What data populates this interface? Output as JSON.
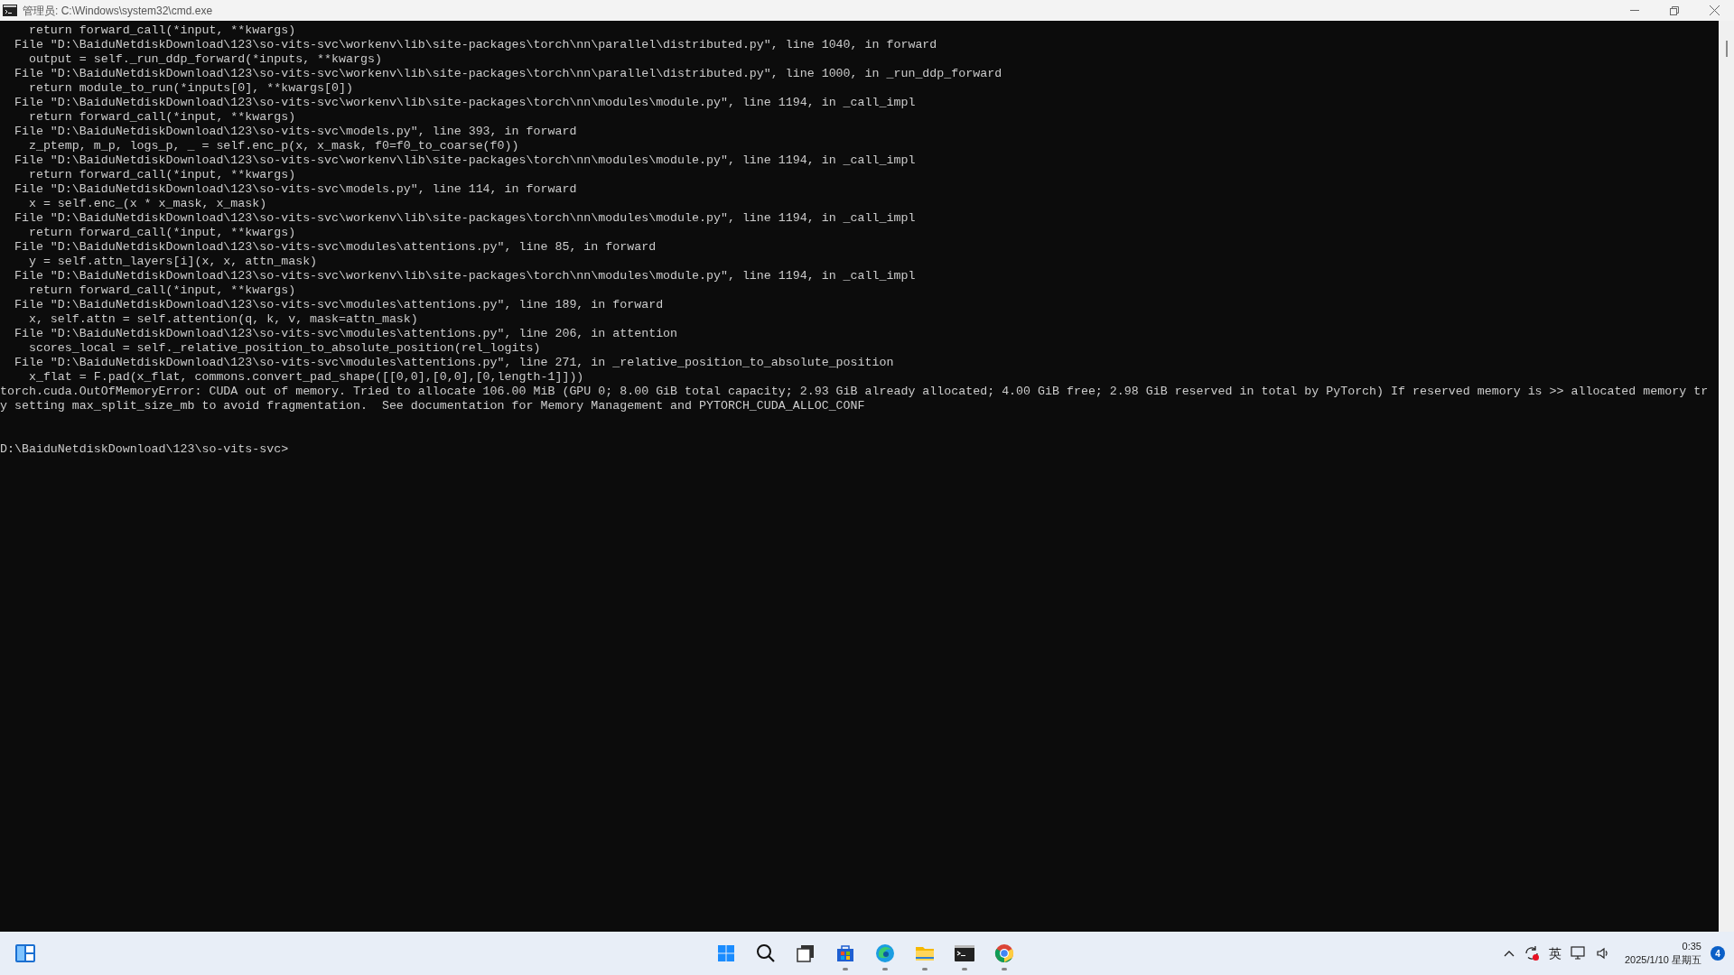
{
  "window": {
    "title": "管理员: C:\\Windows\\system32\\cmd.exe"
  },
  "console": {
    "lines": [
      "    return forward_call(*input, **kwargs)",
      "  File \"D:\\BaiduNetdiskDownload\\123\\so-vits-svc\\workenv\\lib\\site-packages\\torch\\nn\\parallel\\distributed.py\", line 1040, in forward",
      "    output = self._run_ddp_forward(*inputs, **kwargs)",
      "  File \"D:\\BaiduNetdiskDownload\\123\\so-vits-svc\\workenv\\lib\\site-packages\\torch\\nn\\parallel\\distributed.py\", line 1000, in _run_ddp_forward",
      "    return module_to_run(*inputs[0], **kwargs[0])",
      "  File \"D:\\BaiduNetdiskDownload\\123\\so-vits-svc\\workenv\\lib\\site-packages\\torch\\nn\\modules\\module.py\", line 1194, in _call_impl",
      "    return forward_call(*input, **kwargs)",
      "  File \"D:\\BaiduNetdiskDownload\\123\\so-vits-svc\\models.py\", line 393, in forward",
      "    z_ptemp, m_p, logs_p, _ = self.enc_p(x, x_mask, f0=f0_to_coarse(f0))",
      "  File \"D:\\BaiduNetdiskDownload\\123\\so-vits-svc\\workenv\\lib\\site-packages\\torch\\nn\\modules\\module.py\", line 1194, in _call_impl",
      "    return forward_call(*input, **kwargs)",
      "  File \"D:\\BaiduNetdiskDownload\\123\\so-vits-svc\\models.py\", line 114, in forward",
      "    x = self.enc_(x * x_mask, x_mask)",
      "  File \"D:\\BaiduNetdiskDownload\\123\\so-vits-svc\\workenv\\lib\\site-packages\\torch\\nn\\modules\\module.py\", line 1194, in _call_impl",
      "    return forward_call(*input, **kwargs)",
      "  File \"D:\\BaiduNetdiskDownload\\123\\so-vits-svc\\modules\\attentions.py\", line 85, in forward",
      "    y = self.attn_layers[i](x, x, attn_mask)",
      "  File \"D:\\BaiduNetdiskDownload\\123\\so-vits-svc\\workenv\\lib\\site-packages\\torch\\nn\\modules\\module.py\", line 1194, in _call_impl",
      "    return forward_call(*input, **kwargs)",
      "  File \"D:\\BaiduNetdiskDownload\\123\\so-vits-svc\\modules\\attentions.py\", line 189, in forward",
      "    x, self.attn = self.attention(q, k, v, mask=attn_mask)",
      "  File \"D:\\BaiduNetdiskDownload\\123\\so-vits-svc\\modules\\attentions.py\", line 206, in attention",
      "    scores_local = self._relative_position_to_absolute_position(rel_logits)",
      "  File \"D:\\BaiduNetdiskDownload\\123\\so-vits-svc\\modules\\attentions.py\", line 271, in _relative_position_to_absolute_position",
      "    x_flat = F.pad(x_flat, commons.convert_pad_shape([[0,0],[0,0],[0,length-1]]))",
      "torch.cuda.OutOfMemoryError: CUDA out of memory. Tried to allocate 106.00 MiB (GPU 0; 8.00 GiB total capacity; 2.93 GiB already allocated; 4.00 GiB free; 2.98 GiB reserved in total by PyTorch) If reserved memory is >> allocated memory tr",
      "y setting max_split_size_mb to avoid fragmentation.  See documentation for Memory Management and PYTORCH_CUDA_ALLOC_CONF"
    ],
    "prompt": "D:\\BaiduNetdiskDownload\\123\\so-vits-svc>"
  },
  "taskbar": {
    "apps": [
      {
        "kind": "start",
        "running": false
      },
      {
        "kind": "search",
        "running": false
      },
      {
        "kind": "taskview",
        "running": false
      },
      {
        "kind": "store",
        "running": true
      },
      {
        "kind": "edge",
        "running": true
      },
      {
        "kind": "explorer",
        "running": true
      },
      {
        "kind": "terminal",
        "running": true
      },
      {
        "kind": "chrome",
        "running": true
      }
    ],
    "input_method": "英",
    "time": "0:35",
    "date": "2025/1/10 星期五",
    "notification_count": "4"
  }
}
